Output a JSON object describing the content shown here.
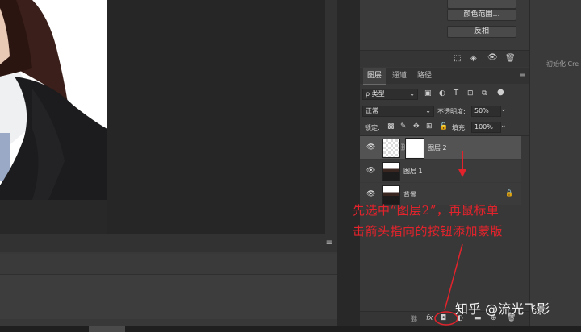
{
  "top_buttons": [
    "颜色范围…",
    "反相"
  ],
  "channels_actions": [
    "dotted-selection-icon",
    "channel-to-selection-icon",
    "eye-icon",
    "trash-icon"
  ],
  "side_note": "初始化 Cre",
  "tabs": [
    "图层",
    "通道",
    "路径"
  ],
  "filter": {
    "kind": "ρ 类型"
  },
  "blend": {
    "mode": "正常",
    "opacity_label": "不透明度:",
    "opacity_value": "50%"
  },
  "lock": {
    "label": "锁定:",
    "fill_label": "填充:",
    "fill_value": "100%"
  },
  "layers": [
    {
      "name": "图层 2",
      "selected": true
    },
    {
      "name": "图层 1",
      "selected": false
    },
    {
      "name": "背景",
      "selected": false,
      "locked": true
    }
  ],
  "annotation": {
    "line1": "先选中“图层2”，再鼠标单",
    "line2": "击箭头指向的按钮添加蒙版"
  },
  "watermark": "知乎 @流光飞影",
  "bottom_bar_icons": [
    "link-icon",
    "fx-icon",
    "add-mask-icon",
    "adjustment-icon",
    "folder-icon",
    "new-layer-icon",
    "trash-icon"
  ],
  "colors": {
    "annotation_red": "#e3232c",
    "panel_bg": "#383838",
    "canvas_bg": "#282828"
  }
}
